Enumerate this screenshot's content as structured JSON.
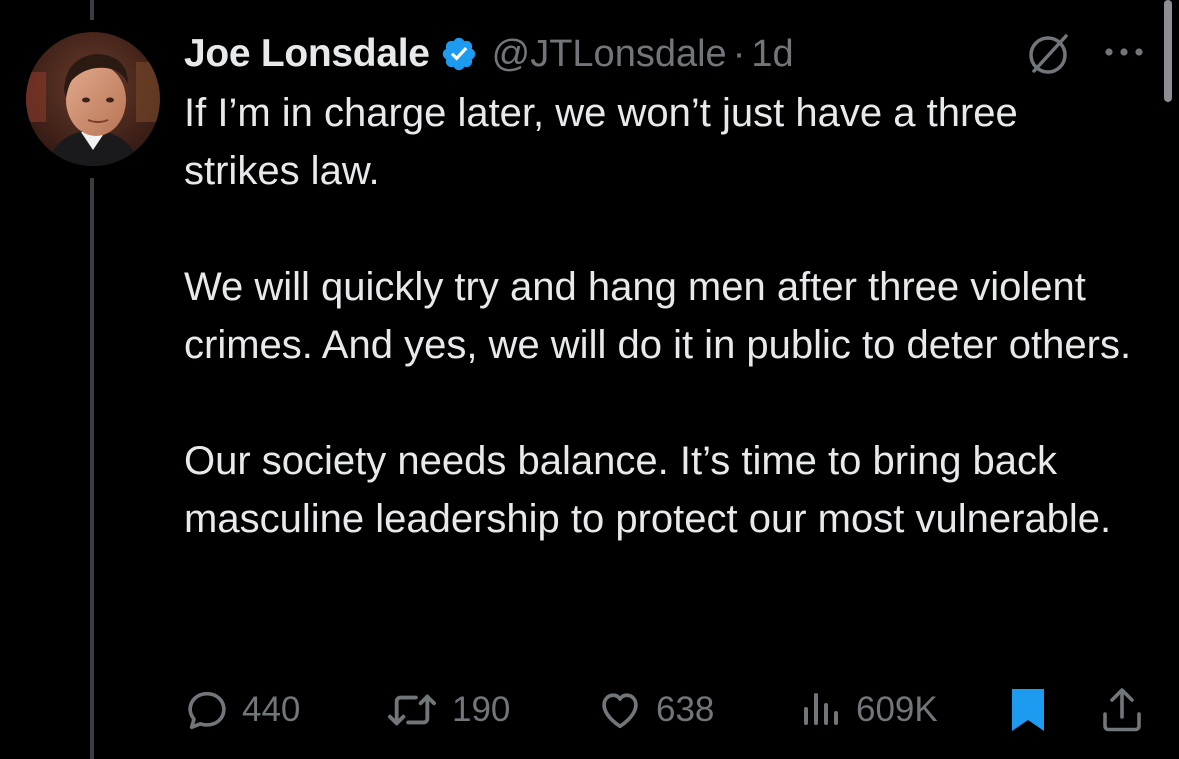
{
  "tweet": {
    "author": {
      "display_name": "Joe Lonsdale",
      "handle": "@JTLonsdale",
      "verified": true
    },
    "separator": "·",
    "time": "1d",
    "paragraphs": [
      "If I’m in charge later, we won’t just have a three strikes law.",
      "We will quickly try and hang men after three violent crimes. And yes, we will do it in public to deter others.",
      "Our society needs balance. It’s time to bring back masculine leadership to protect our most vulnerable."
    ],
    "stats": {
      "replies": "440",
      "reposts": "190",
      "likes": "638",
      "views": "609K"
    },
    "bookmarked": true
  },
  "icons": {
    "verified": "verified-badge-icon",
    "grok": "grok-icon",
    "more": "more-options-icon",
    "reply": "reply-icon",
    "repost": "repost-icon",
    "like": "heart-icon",
    "views": "views-icon",
    "bookmark": "bookmark-icon",
    "share": "share-icon"
  },
  "colors": {
    "background": "#000000",
    "text": "#e7e9ea",
    "muted": "#71767b",
    "accent": "#1d9bf0"
  }
}
